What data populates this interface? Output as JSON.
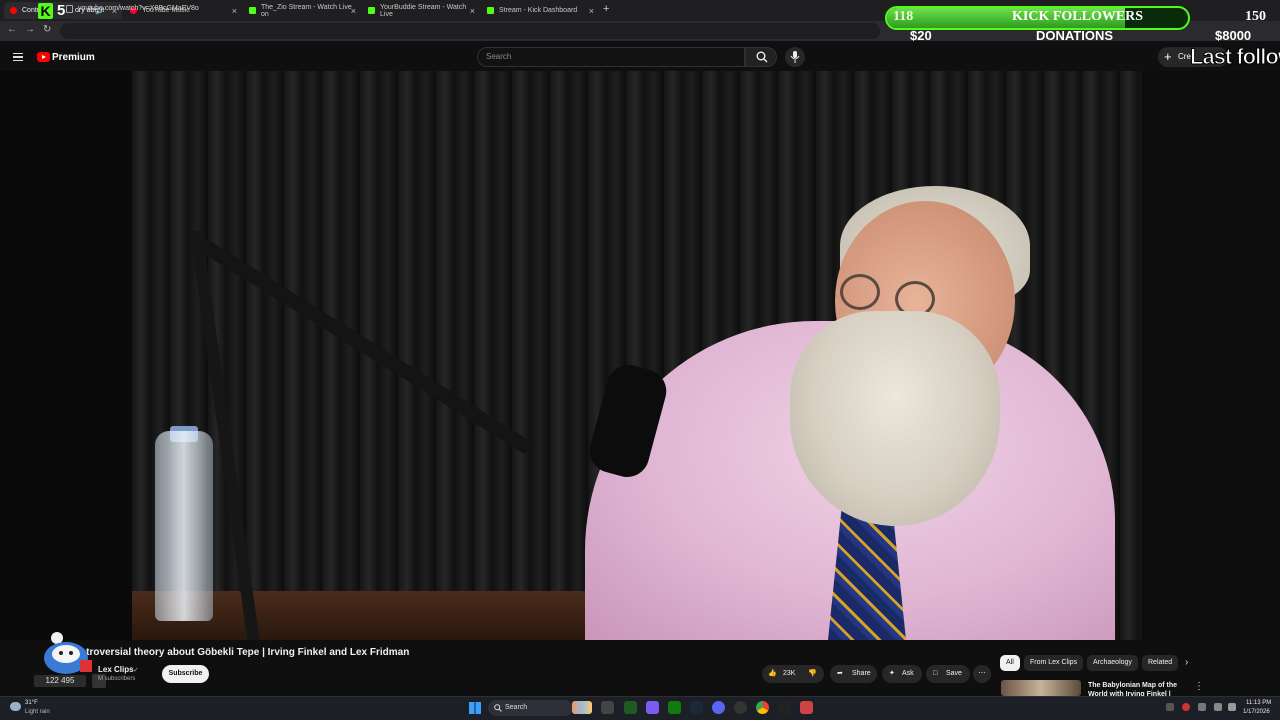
{
  "browser": {
    "tabs": [
      {
        "label": "Contro",
        "suffix": "ory about",
        "active": true,
        "favicon": "youtube-icon"
      },
      {
        "label": "YouTube Music",
        "active": false,
        "favicon": "youtube-music-icon"
      },
      {
        "label": "The_Zio Stream - Watch Live on",
        "active": false,
        "favicon": "kick-icon"
      },
      {
        "label": "YourBuddie Stream - Watch Live",
        "active": false,
        "favicon": "kick-icon"
      },
      {
        "label": "Stream - Kick Dashboard",
        "active": false,
        "favicon": "kick-icon"
      }
    ],
    "url": "youtube.com/watch?v=X0BcGMaEV8o"
  },
  "youtube": {
    "logo_label": "Premium",
    "search_placeholder": "Search",
    "create_label": "Crea",
    "video_title": "ntroversial theory about Göbekli Tepe | Irving Finkel and Lex Fridman",
    "channel_name": "Lex Clips",
    "channel_subs": "M subscribers",
    "subscribe_label": "Subscribe",
    "likes": "23K",
    "share_label": "Share",
    "ask_label": "Ask",
    "save_label": "Save",
    "chips": [
      "All",
      "From Lex Clips",
      "Archaeology",
      "Related"
    ],
    "recommended_title": "The Babylonian Map of the World with Irving Finkel |"
  },
  "overlay": {
    "followers_count": "118",
    "followers_title": "KICK FOLLOWERS",
    "followers_goal": "150",
    "followers_progress": 0.79,
    "donations_amount": "$20",
    "donations_title": "DONATIONS",
    "donations_goal": "$8000",
    "last_follower_label": "Last followe",
    "kick_digit": "5",
    "viewer_count": "122 495",
    "accent": "#53fc18"
  },
  "taskbar": {
    "weather_temp": "31°F",
    "weather_desc": "Light rain",
    "search_label": "Search",
    "time": "11:13 PM",
    "date": "1/17/2026"
  }
}
